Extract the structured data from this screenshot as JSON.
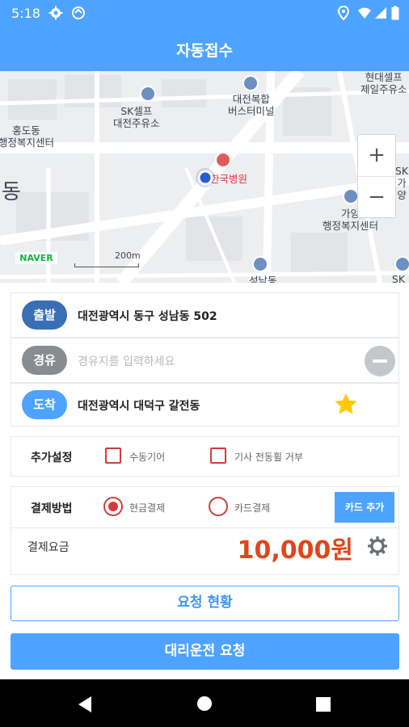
{
  "status_bar": {
    "time": "5:18"
  },
  "app_bar": {
    "title": "자동접수"
  },
  "map": {
    "pois": [
      {
        "name": "SK셀프\n대전주유소"
      },
      {
        "name": "대전복합\n버스터미널"
      },
      {
        "name": "현대셀프\n제일주유소"
      },
      {
        "name": "홍도동\n행정복지센터"
      },
      {
        "name": "동"
      },
      {
        "name": "한국병원"
      },
      {
        "name": "가양\n행정복지센터"
      },
      {
        "name": "SK\n가양"
      },
      {
        "name": "SK셀"
      },
      {
        "name": "성남동"
      }
    ],
    "zoom_in": "+",
    "zoom_out": "−",
    "logo": "NAVER",
    "scale_label": "200m"
  },
  "route": {
    "departure": {
      "tag": "출발",
      "address": "대전광역시 동구 성남동 502",
      "color": "#3a6fb3"
    },
    "waypoint": {
      "tag": "경유",
      "placeholder": "경유지를 입력하세요",
      "color": "#8a8d90"
    },
    "arrival": {
      "tag": "도착",
      "address": "대전광역시 대덕구 갈전동",
      "color": "#4da3ff"
    }
  },
  "extra_settings": {
    "label": "추가설정",
    "options": [
      {
        "label": "수동기어",
        "checked": false
      },
      {
        "label": "기사 전동휠 거부",
        "checked": false
      }
    ]
  },
  "payment": {
    "label": "결제방법",
    "options": [
      {
        "label": "현금결제",
        "selected": true
      },
      {
        "label": "카드결제",
        "selected": false
      }
    ],
    "add_card": "카드 추가"
  },
  "fare": {
    "label": "결제요금",
    "amount": "10,000원",
    "amount_color": "#e0461a"
  },
  "buttons": {
    "status": "요청 현황",
    "request": "대리운전 요청"
  }
}
